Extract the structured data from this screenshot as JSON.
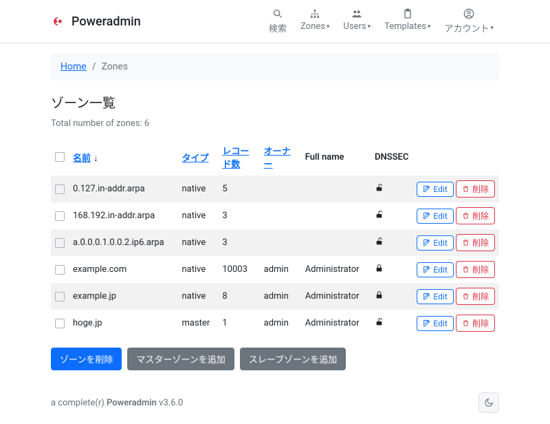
{
  "brand": "Poweradmin",
  "nav": {
    "search": "検索",
    "zones": "Zones",
    "users": "Users",
    "templates": "Templates",
    "account": "アカウント"
  },
  "breadcrumb": {
    "home": "Home",
    "current": "Zones"
  },
  "title": "ゾーン一覧",
  "subtitle": "Total number of zones: 6",
  "columns": {
    "name": "名前",
    "type": "タイプ",
    "records": "レコード数",
    "owner": "オーナー",
    "fullname": "Full name",
    "dnssec": "DNSSEC"
  },
  "sort_marker": "↓",
  "zones": [
    {
      "name": "0.127.in-addr.arpa",
      "type": "native",
      "records": "5",
      "owner": "",
      "fullname": "",
      "locked": false
    },
    {
      "name": "168.192.in-addr.arpa",
      "type": "native",
      "records": "3",
      "owner": "",
      "fullname": "",
      "locked": false
    },
    {
      "name": "a.0.0.0.1.0.0.2.ip6.arpa",
      "type": "native",
      "records": "3",
      "owner": "",
      "fullname": "",
      "locked": false
    },
    {
      "name": "example.com",
      "type": "native",
      "records": "10003",
      "owner": "admin",
      "fullname": "Administrator",
      "locked": true
    },
    {
      "name": "example.jp",
      "type": "native",
      "records": "8",
      "owner": "admin",
      "fullname": "Administrator",
      "locked": true
    },
    {
      "name": "hoge.jp",
      "type": "master",
      "records": "1",
      "owner": "admin",
      "fullname": "Administrator",
      "locked": false
    }
  ],
  "buttons": {
    "edit": "Edit",
    "delete": "削除",
    "delete_zone": "ゾーンを削除",
    "add_master": "マスターゾーンを追加",
    "add_slave": "スレーブゾーンを追加"
  },
  "footer": {
    "prefix": "a complete(r) ",
    "name": "Poweradmin",
    "version": " v3.6.0"
  }
}
